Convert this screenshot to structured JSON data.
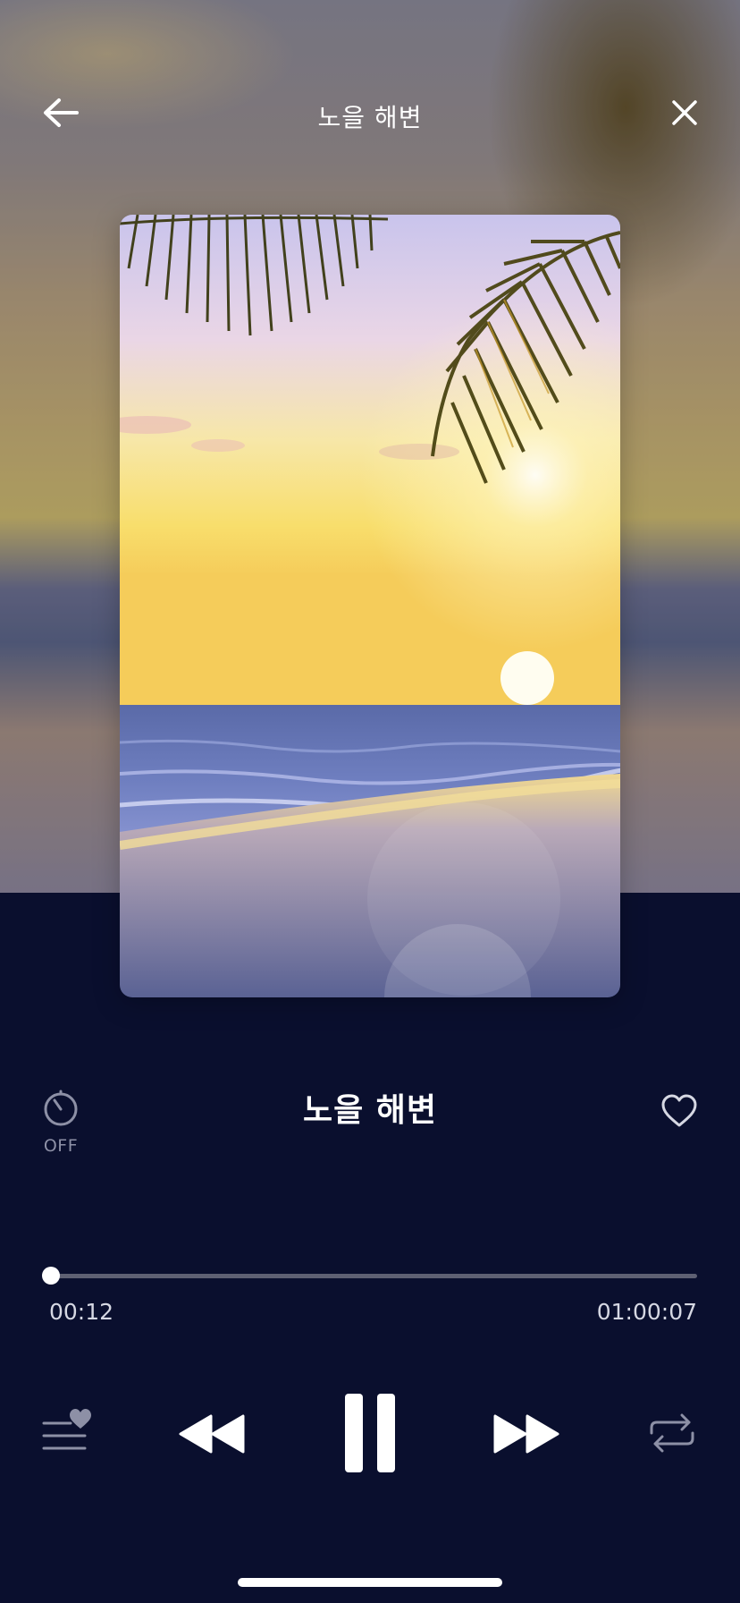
{
  "header": {
    "title": "노을 해변",
    "back_icon": "arrow-left-icon",
    "close_icon": "close-icon"
  },
  "artwork": {
    "description_icon": "beach-sunset-artwork"
  },
  "track": {
    "title": "노을 해변",
    "favorite_icon": "heart-outline-icon"
  },
  "timer": {
    "label": "OFF",
    "icon": "timer-icon"
  },
  "progress": {
    "current": "00:12",
    "total": "01:00:07",
    "fraction": 0.003
  },
  "controls": {
    "playlist_icon": "favorite-playlist-icon",
    "rewind_icon": "rewind-icon",
    "pause_icon": "pause-icon",
    "forward_icon": "fast-forward-icon",
    "repeat_icon": "repeat-icon"
  },
  "colors": {
    "background": "#0a0f2e",
    "accent": "#ffffff",
    "muted": "#8d90a6",
    "track": "#5e6073"
  }
}
